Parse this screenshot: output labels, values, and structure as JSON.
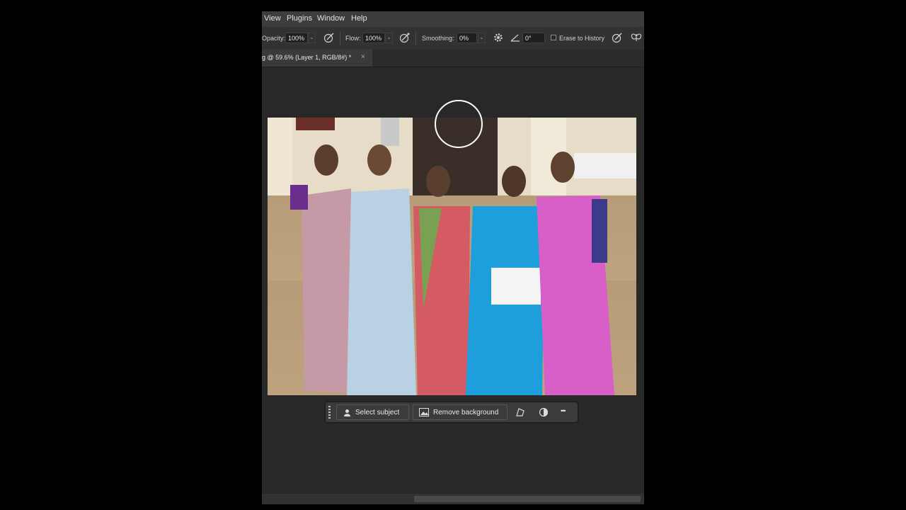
{
  "menubar": {
    "items": [
      "View",
      "Plugins",
      "Window",
      "Help"
    ]
  },
  "options_bar": {
    "opacity_label": "Opacity:",
    "opacity_value": "100%",
    "flow_label": "Flow:",
    "flow_value": "100%",
    "smoothing_label": "Smoothing:",
    "smoothing_value": "0%",
    "angle_value": "0°",
    "erase_to_history_label": "Erase to History",
    "erase_to_history_checked": false
  },
  "document_tab": {
    "title": "g @ 59.6% (Layer 1, RGB/8#) *",
    "close": "×"
  },
  "contextual_taskbar": {
    "select_subject_label": "Select subject",
    "remove_background_label": "Remove background",
    "more_label": "•••"
  },
  "colors": {
    "app_bg": "#282828",
    "menubar_bg": "#3d3d3d",
    "options_bg": "#323232",
    "tab_bg": "#3a3a3a"
  },
  "icons": [
    "airbrush-icon",
    "pressure-icon",
    "gear-icon",
    "angle-icon",
    "tablet-pressure-icon",
    "symmetry-butterfly-icon",
    "close-icon",
    "person-icon",
    "image-icon",
    "transform-icon",
    "contrast-icon",
    "more-icon"
  ]
}
